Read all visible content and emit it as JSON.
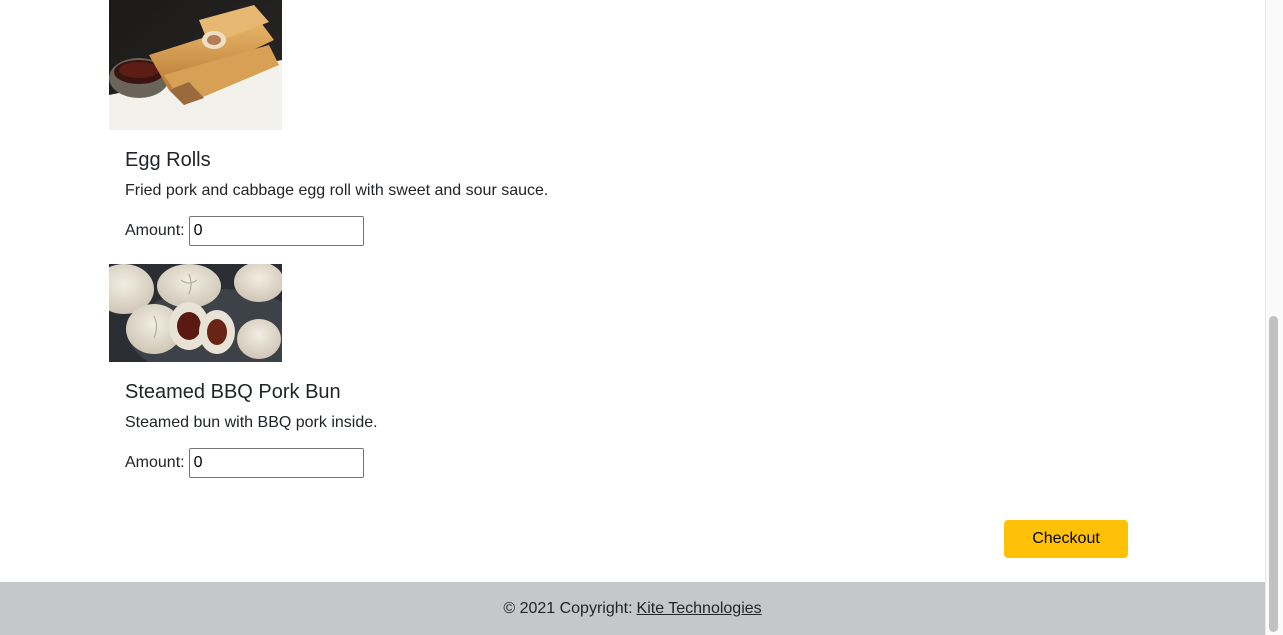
{
  "menu": {
    "items": [
      {
        "name": "Egg Rolls",
        "description": "Fried pork and cabbage egg roll with sweet and sour sauce.",
        "amount_label": "Amount:",
        "amount_value": "0",
        "image_icon": "egg-rolls-photo"
      },
      {
        "name": "Steamed BBQ Pork Bun",
        "description": "Steamed bun with BBQ pork inside.",
        "amount_label": "Amount:",
        "amount_value": "0",
        "image_icon": "pork-bun-photo"
      }
    ],
    "checkout_label": "Checkout"
  },
  "footer": {
    "copyright": "© 2021 Copyright:",
    "link_text": "Kite Technologies"
  },
  "colors": {
    "checkout_button": "#ffc107",
    "footer_background": "#c6c7c9"
  }
}
